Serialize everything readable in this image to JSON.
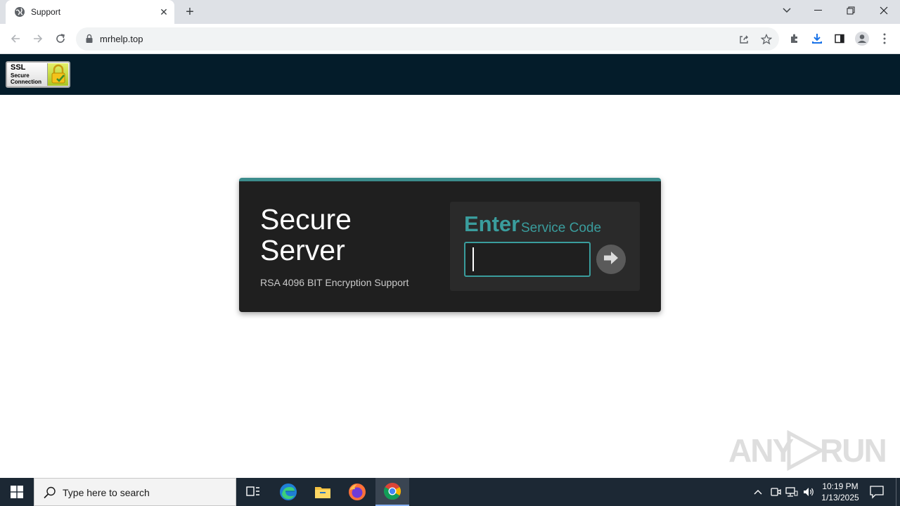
{
  "browser": {
    "tab_title": "Support",
    "url": "mrhelp.top"
  },
  "site": {
    "badge_title": "SSL",
    "badge_line1": "Secure",
    "badge_line2": "Connection"
  },
  "card": {
    "heading_line1": "Secure",
    "heading_line2": "Server",
    "subtitle": "RSA 4096 BIT Encryption Support",
    "enter_label": "Enter",
    "service_label": "Service Code",
    "code_value": "",
    "accent_color": "#3a9d9d"
  },
  "watermark": {
    "text_left": "ANY",
    "text_right": "RUN"
  },
  "taskbar": {
    "search_placeholder": "Type here to search",
    "time": "10:19 PM",
    "date": "1/13/2025"
  }
}
